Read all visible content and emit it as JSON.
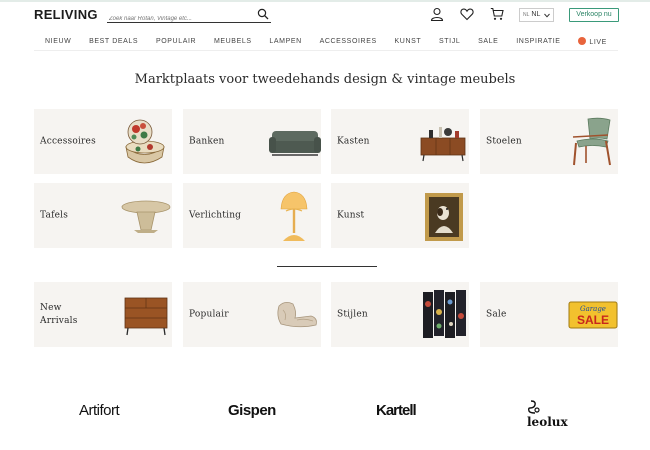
{
  "header": {
    "logo": "RELIVING",
    "search_placeholder": "Zoek naar Rotan, Vintage etc...",
    "language_flag": "NL",
    "language": "NL",
    "sell_button": "Verkoop nu",
    "icons": [
      "search-icon",
      "account-icon",
      "heart-icon",
      "cart-icon",
      "chevron-down-icon"
    ]
  },
  "nav": {
    "items": [
      "NIEUW",
      "BEST DEALS",
      "POPULAIR",
      "MEUBELS",
      "LAMPEN",
      "ACCESSOIRES",
      "KUNST",
      "STIJL",
      "SALE",
      "INSPIRATIE"
    ],
    "live": "LIVE"
  },
  "main": {
    "title": "Marktplaats voor tweedehands design & vintage meubels",
    "categories": [
      "Accessoires",
      "Banken",
      "Kasten",
      "Stoelen",
      "Tafels",
      "Verlichting",
      "Kunst"
    ],
    "collections": [
      "New Arrivals",
      "Populair",
      "Stijlen",
      "Sale"
    ],
    "sale_sign": [
      "Garage",
      "SALE"
    ]
  },
  "brands": [
    "Artifort",
    "Gispen",
    "Kartell",
    "leolux"
  ],
  "colors": {
    "accent": "#2c8466",
    "tile_bg": "#f6f4f1",
    "live_dot": "#e8643c",
    "sale_sign": "#f2c12e"
  }
}
